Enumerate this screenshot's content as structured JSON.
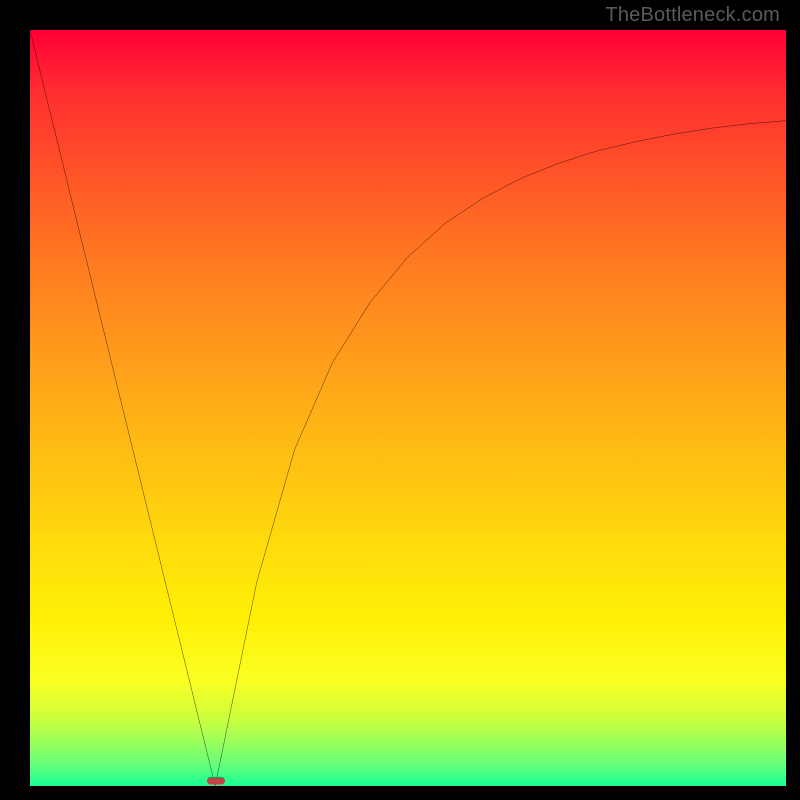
{
  "watermark": "TheBottleneck.com",
  "chart_data": {
    "type": "line",
    "title": "",
    "xlabel": "",
    "ylabel": "",
    "xlim": [
      0,
      100
    ],
    "ylim": [
      0,
      100
    ],
    "linear_segment": {
      "x": [
        0,
        24.5
      ],
      "y": [
        100,
        0
      ]
    },
    "asymptotic_segment": {
      "x": [
        24.5,
        30,
        35,
        40,
        45,
        50,
        55,
        60,
        65,
        70,
        75,
        80,
        85,
        90,
        95,
        100
      ],
      "y": [
        0,
        27.0,
        44.5,
        56.0,
        64.0,
        70.0,
        74.5,
        77.8,
        80.4,
        82.4,
        84.0,
        85.2,
        86.2,
        87.0,
        87.6,
        88.0
      ]
    },
    "marker": {
      "x": 24.5,
      "y": 0.5,
      "color": "#b94a48",
      "shape": "rounded-cap"
    },
    "gradient_background": {
      "top_color": "#ff0034",
      "mid_colors": [
        "#ff8e1e",
        "#ffdb0c",
        "#faff23"
      ],
      "bottom_color": "#18ff97"
    }
  }
}
